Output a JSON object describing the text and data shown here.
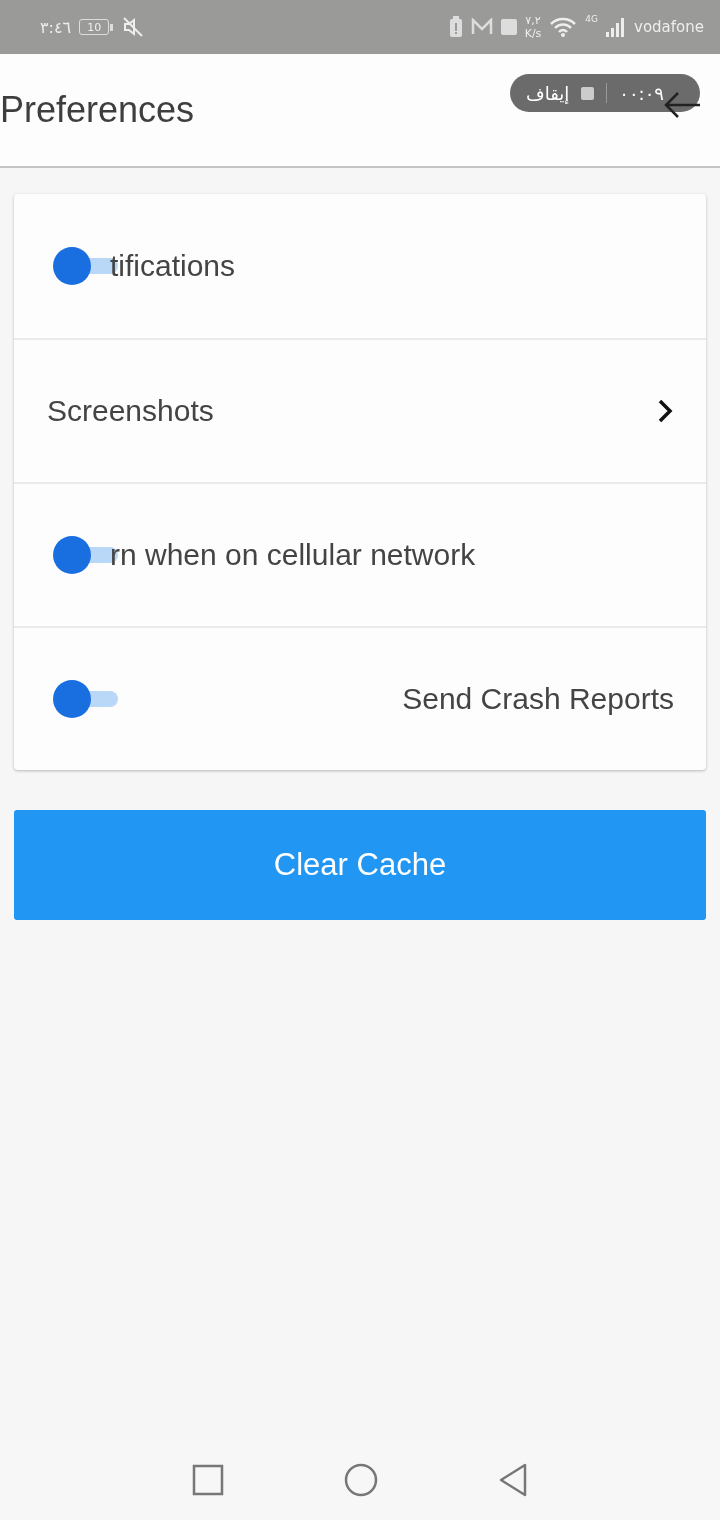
{
  "status_bar": {
    "time": "٣:٤٦",
    "battery": "10",
    "speed_value": "٧,٢",
    "speed_unit": "K/s",
    "network": "4G",
    "carrier": "vodafone"
  },
  "recorder": {
    "stop_label": "إيقاف",
    "elapsed": "٠٠:٠٩"
  },
  "header": {
    "title": "Preferences"
  },
  "settings": [
    {
      "kind": "toggle",
      "label": "tifications",
      "on": false
    },
    {
      "kind": "link",
      "label": "Screenshots"
    },
    {
      "kind": "toggle",
      "label": "rn when on cellular network",
      "on": false
    },
    {
      "kind": "toggle_right",
      "label": "Send Crash Reports",
      "on": false
    }
  ],
  "action_button": {
    "label": "Clear Cache"
  }
}
